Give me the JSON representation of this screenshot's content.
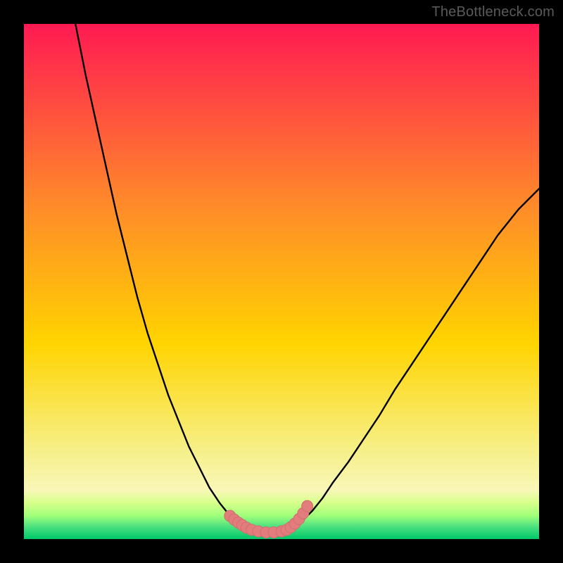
{
  "watermark": "TheBottleneck.com",
  "accent_colors": {
    "curve": "#000000",
    "marker_fill": "#e37c7c",
    "marker_stroke": "#cf6f6f",
    "gradient_top": "#ff1a52",
    "gradient_mid": "#ffd400",
    "gradient_bottom_band": "#ccff66",
    "gradient_bottom": "#00c96b",
    "frame": "#000000"
  },
  "chart_data": {
    "type": "line",
    "title": "",
    "xlabel": "",
    "ylabel": "",
    "xlim": [
      0,
      100
    ],
    "ylim": [
      0,
      100
    ],
    "grid": false,
    "legend": false,
    "series": [
      {
        "name": "left-curve",
        "x": [
          10,
          12,
          14,
          16,
          18,
          20,
          22,
          24,
          26,
          28,
          30,
          32,
          34,
          36,
          38,
          40,
          41,
          42,
          43,
          44,
          45
        ],
        "y": [
          100,
          90,
          81,
          72,
          63,
          55,
          47,
          40,
          34,
          28,
          23,
          18,
          14,
          10,
          7,
          4.5,
          3.5,
          2.8,
          2.2,
          1.8,
          1.5
        ]
      },
      {
        "name": "valley-floor",
        "x": [
          45,
          46,
          47,
          48,
          49,
          50,
          51,
          52
        ],
        "y": [
          1.5,
          1.3,
          1.2,
          1.2,
          1.25,
          1.4,
          1.6,
          2.0
        ]
      },
      {
        "name": "right-curve",
        "x": [
          52,
          54,
          56,
          58,
          60,
          63,
          66,
          69,
          72,
          76,
          80,
          84,
          88,
          92,
          96,
          100
        ],
        "y": [
          2.0,
          3.5,
          5.5,
          8,
          11,
          15,
          19.5,
          24,
          29,
          35,
          41,
          47,
          53,
          59,
          64,
          68
        ]
      }
    ],
    "markers": {
      "name": "highlight-dots",
      "points_x": [
        40.0,
        40.8,
        41.6,
        42.4,
        43.2,
        44.2,
        45.5,
        47.0,
        48.5,
        50.0,
        51.0,
        51.8,
        52.6,
        53.4,
        54.2,
        55.0
      ],
      "points_y": [
        4.5,
        3.8,
        3.2,
        2.7,
        2.2,
        1.8,
        1.5,
        1.3,
        1.3,
        1.5,
        1.8,
        2.3,
        3.0,
        3.9,
        5.0,
        6.4
      ],
      "radius": 8
    },
    "background_gradient": {
      "stops": [
        {
          "offset": 0.0,
          "color": "#ff1a52"
        },
        {
          "offset": 0.35,
          "color": "#ff8a2a"
        },
        {
          "offset": 0.62,
          "color": "#ffd400"
        },
        {
          "offset": 0.83,
          "color": "#f6f08a"
        },
        {
          "offset": 0.905,
          "color": "#f9f7b8"
        },
        {
          "offset": 0.93,
          "color": "#d6ff8a"
        },
        {
          "offset": 0.955,
          "color": "#9fff7a"
        },
        {
          "offset": 0.975,
          "color": "#4fe27f"
        },
        {
          "offset": 1.0,
          "color": "#00c96b"
        }
      ]
    }
  }
}
